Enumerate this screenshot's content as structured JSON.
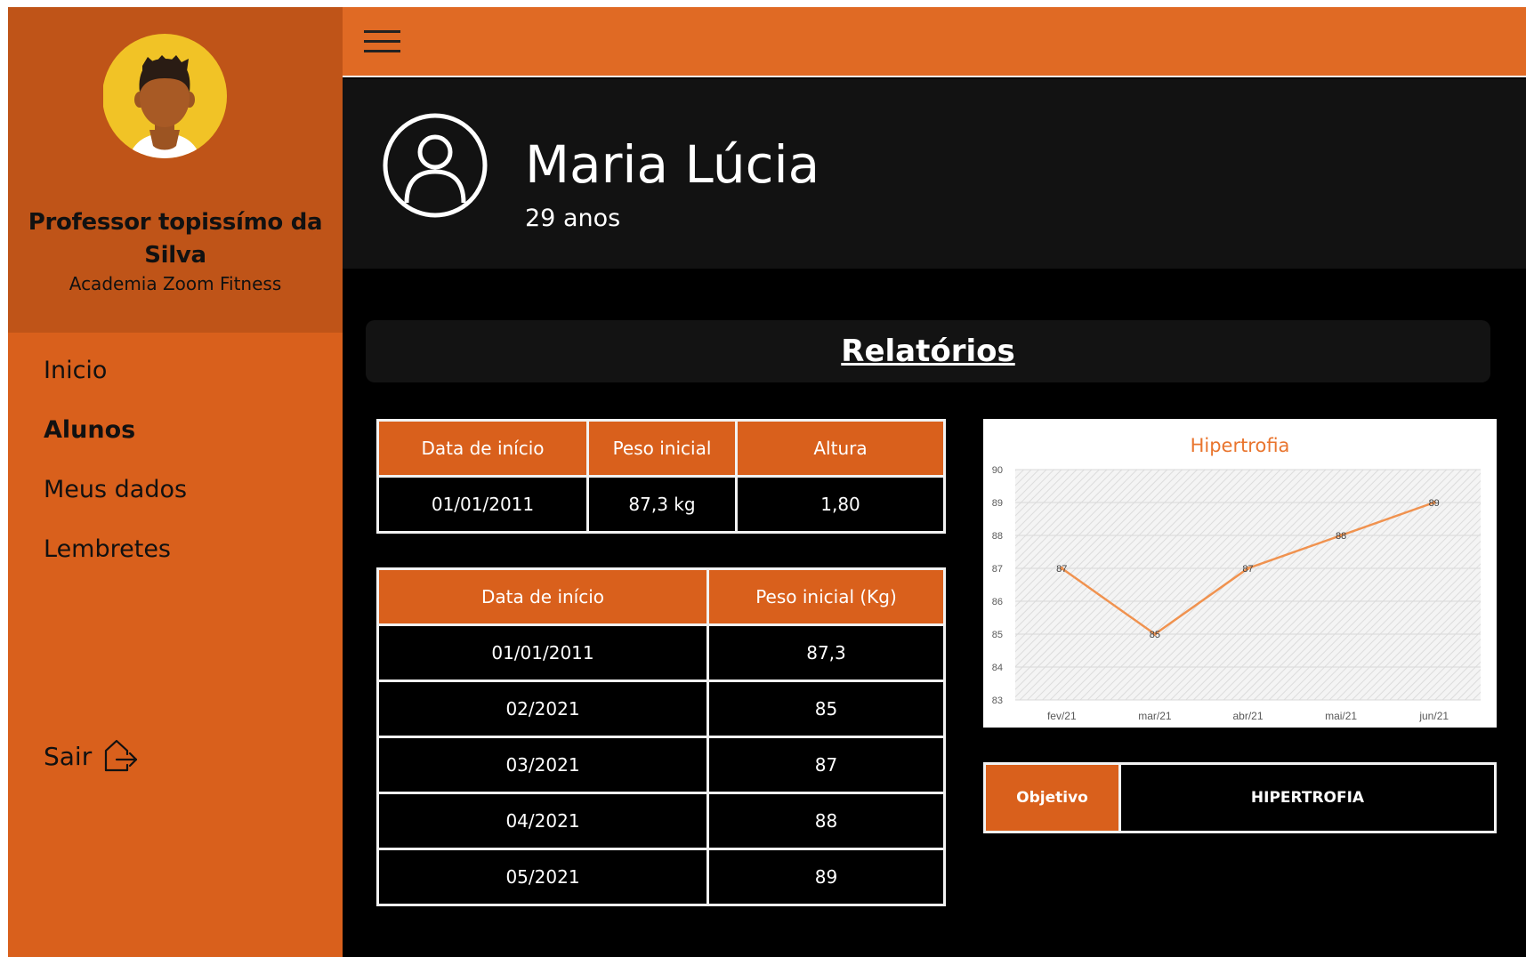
{
  "sidebar": {
    "professor_name": "Professor topissímo da Silva",
    "gym": "Academia Zoom Fitness",
    "nav": [
      {
        "label": "Inicio",
        "active": false
      },
      {
        "label": "Alunos",
        "active": true
      },
      {
        "label": "Meus dados",
        "active": false
      },
      {
        "label": "Lembretes",
        "active": false
      }
    ],
    "logout_label": "Sair",
    "logout_icon": "logout-icon"
  },
  "topbar": {
    "menu_icon": "hamburger-menu-icon"
  },
  "student": {
    "name": "Maria Lúcia",
    "age": "29 anos",
    "icon": "user-circle-icon"
  },
  "section": {
    "title": "Relatórios"
  },
  "summary_table": {
    "headers": [
      "Data de início",
      "Peso inicial",
      "Altura"
    ],
    "row": [
      "01/01/2011",
      "87,3 kg",
      "1,80"
    ]
  },
  "history_table": {
    "headers": [
      "Data de início",
      "Peso inicial (Kg)"
    ],
    "rows": [
      [
        "01/01/2011",
        "87,3"
      ],
      [
        "02/2021",
        "85"
      ],
      [
        "03/2021",
        "87"
      ],
      [
        "04/2021",
        "88"
      ],
      [
        "05/2021",
        "89"
      ]
    ]
  },
  "chart_data": {
    "type": "line",
    "title": "Hipertrofia",
    "categories": [
      "fev/21",
      "mar/21",
      "abr/21",
      "mai/21",
      "jun/21"
    ],
    "values": [
      87,
      85,
      87,
      88,
      89
    ],
    "ylim": [
      83,
      90
    ],
    "yticks": [
      83,
      84,
      85,
      86,
      87,
      88,
      89,
      90
    ],
    "data_labels": true,
    "color": "#f0924f"
  },
  "objective": {
    "label": "Objetivo",
    "value": "HIPERTROFIA"
  },
  "colors": {
    "accent": "#d9601c",
    "topbar": "#e06a24",
    "profile_bg": "#bf5418",
    "avatar_bg": "#f1c326"
  }
}
